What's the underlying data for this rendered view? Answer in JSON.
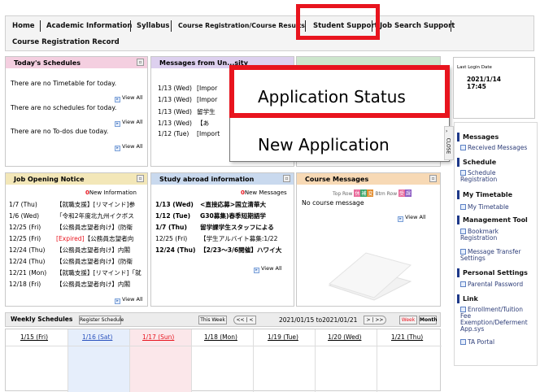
{
  "nav": {
    "items": [
      "Home",
      "Academic Information",
      "Syllabus",
      "Course Registration/Course Results",
      "Student Support",
      "Job Search Support"
    ],
    "second_row": "Course Registration Record"
  },
  "schedules": {
    "title": "Today's Schedules",
    "line1": "There are no Timetable for today.",
    "line2": "There are no schedules for today.",
    "line3": "There are no To-dos due today.",
    "view_all": "View All"
  },
  "messages": {
    "title": "Messages from Un...sity",
    "rows": [
      {
        "date": "1/13 (Wed)",
        "text": "[Impor"
      },
      {
        "date": "1/13 (Wed)",
        "text": "[Impor"
      },
      {
        "date": "1/13 (Wed)",
        "text": "留学生"
      },
      {
        "date": "1/13 (Wed)",
        "text": "【あ"
      },
      {
        "date": "1/12 (Tue)",
        "text": "[Import"
      }
    ]
  },
  "dropdown": {
    "item1": "Application Status",
    "item2": "New Application"
  },
  "login": {
    "label": "Last Login Date",
    "date": "2021/1/14",
    "time": "17:45"
  },
  "close_tab": "CLOSE",
  "sidebar": {
    "sections": [
      {
        "head": "Messages",
        "links": [
          "Received Messages"
        ]
      },
      {
        "head": "Schedule",
        "links": [
          "Schedule Registration"
        ]
      },
      {
        "head": "My Timetable",
        "links": [
          "My Timetable"
        ]
      },
      {
        "head": "Management Tool",
        "links": [
          "Bookmark Registration",
          "Message Transfer Settings"
        ]
      },
      {
        "head": "Personal Settings",
        "links": [
          "Parental Password"
        ]
      },
      {
        "head": "Link",
        "links": [
          "Enrollment/Tuition Fee Exemption/Deferment App.sys",
          "TA Portal"
        ]
      }
    ]
  },
  "jobs": {
    "title": "Job Opening Notice",
    "new_count": "0",
    "new_label": "New Information",
    "rows": [
      {
        "date": "1/7 (Thu)",
        "text": "【就職支援】[リマインド]参"
      },
      {
        "date": "1/6 (Wed)",
        "text": "「令和2年度北九州イクボス"
      },
      {
        "date": "12/25 (Fri)",
        "text": "【公務員志望者向け】(防衛"
      },
      {
        "date": "12/25 (Fri)",
        "expired": "[Expired]",
        "text": "【公務員志望者向"
      },
      {
        "date": "12/24 (Thu)",
        "text": "【公務員志望者向け】内閣"
      },
      {
        "date": "12/24 (Thu)",
        "text": "【公務員志望者向け】(防衛"
      },
      {
        "date": "12/21 (Mon)",
        "text": "【就職支援】[リマインド]「就"
      },
      {
        "date": "12/18 (Fri)",
        "text": "【公務員志望者向け】内閣"
      }
    ],
    "view_all": "View All"
  },
  "abroad": {
    "title": "Study abroad information",
    "new_count": "0",
    "new_label": "New Messages",
    "rows": [
      {
        "date": "1/13 (Wed)",
        "text": "<直接応募>国立清華大"
      },
      {
        "date": "1/12 (Tue)",
        "text": "G30募集)春季短期語学"
      },
      {
        "date": "1/7 (Thu)",
        "text": "留学課学生スタッフによる"
      },
      {
        "date": "12/25 (Fri)",
        "text": "【学生アルバイト募集:1/22"
      },
      {
        "date": "12/24 (Thu)",
        "text": "【2/23〜3/6開催】ハワイ大"
      }
    ],
    "view_all": "View All"
  },
  "course_msg": {
    "title": "Course Messages",
    "top_row": "Top Row",
    "btm_row": "Btm Row",
    "badges": [
      "休",
      "補",
      "変",
      "受",
      "課",
      "授"
    ],
    "empty": "No course message",
    "view_all": "View All"
  },
  "weekly": {
    "title": "Weekly Schedules",
    "register": "Register Schedule",
    "this_week": "This Week",
    "range": "2021/01/15 to2021/01/21",
    "week": "Week",
    "month": "Month",
    "days": [
      "1/15 (Fri)",
      "1/16 (Sat)",
      "1/17 (Sun)",
      "1/18 (Mon)",
      "1/19 (Tue)",
      "1/20 (Wed)",
      "1/21 (Thu)"
    ]
  },
  "colors": {
    "highlight": "#e8141e",
    "pink_band": "#f4cfe0",
    "purple_band": "#ddd0ef",
    "green_band": "#cde6cd",
    "yellow_band": "#f3e7b8",
    "blue_band": "#c9d9ee",
    "orange_band": "#f7d9b5",
    "sat_bg": "#e6eefb",
    "sun_bg": "#fbe7ea"
  }
}
